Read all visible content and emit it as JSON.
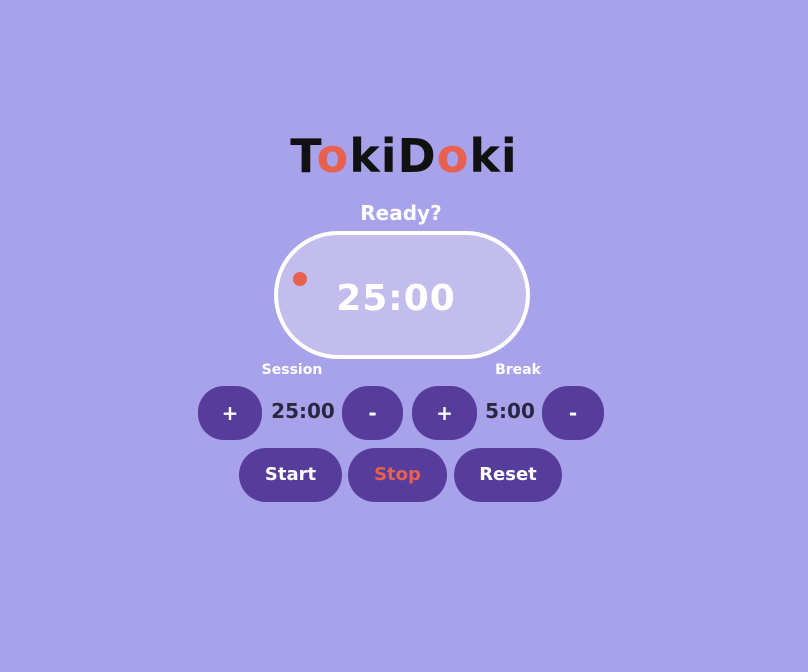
{
  "app": {
    "logo_parts": [
      "T",
      "o",
      "ki",
      "D",
      "o",
      "ki"
    ],
    "status": "Ready?"
  },
  "timer": {
    "display": "25:00"
  },
  "session": {
    "label": "Session",
    "value": "25:00",
    "increment_label": "+",
    "decrement_label": "-"
  },
  "break_": {
    "label": "Break",
    "value": "5:00",
    "increment_label": "+",
    "decrement_label": "-"
  },
  "controls": {
    "start_label": "Start",
    "stop_label": "Stop",
    "reset_label": "Reset"
  },
  "colors": {
    "background": "#a8a2eb",
    "button": "#573d9b",
    "accent": "#e8604f",
    "clock_fill": "#c2bdec",
    "text_light": "#ffffff",
    "text_dark": "#2c2640"
  }
}
